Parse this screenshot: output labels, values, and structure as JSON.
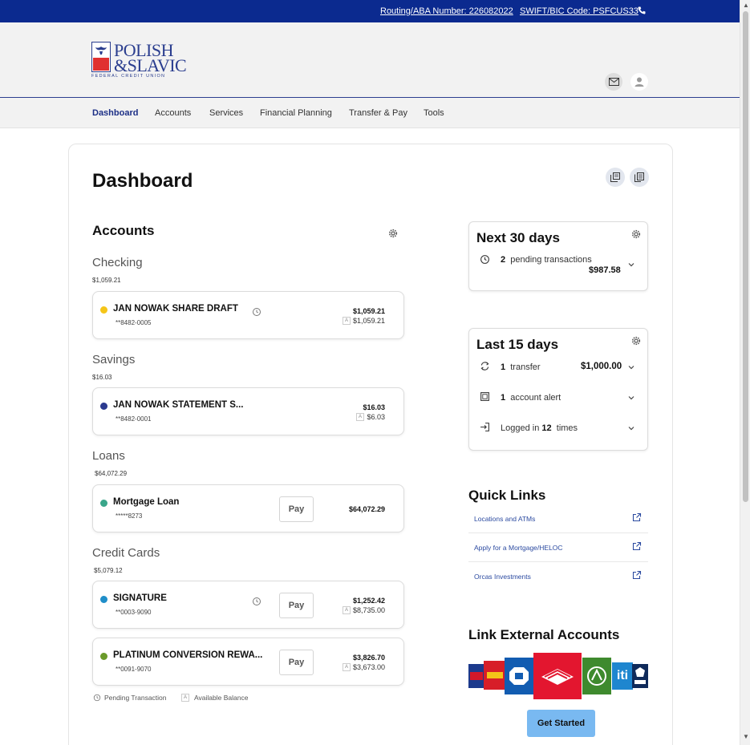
{
  "topbar": {
    "routing": "Routing/ABA Number: 226082022",
    "swift": "SWIFT/BIC Code: PSFCUS33"
  },
  "brand": {
    "line1": "POLISH",
    "line2": "&SLAVIC",
    "line3": "FEDERAL CREDIT UNION"
  },
  "nav": [
    "Dashboard",
    "Accounts",
    "Services",
    "Financial Planning",
    "Transfer & Pay",
    "Tools"
  ],
  "page": {
    "title": "Dashboard"
  },
  "accounts": {
    "heading": "Accounts",
    "checking": {
      "label": "Checking",
      "total": "$1,059.21"
    },
    "savings": {
      "label": "Savings",
      "total": "$16.03"
    },
    "loans": {
      "label": "Loans",
      "total": "$64,072.29"
    },
    "credit": {
      "label": "Credit Cards",
      "total": "$5,079.12"
    },
    "items": [
      {
        "name": "JAN NOWAK SHARE DRAFT",
        "number": "**8482-0005",
        "balance": "$1,059.21",
        "available": "$1,059.21",
        "dot_color": "#f5c518"
      },
      {
        "name": "JAN NOWAK STATEMENT S...",
        "number": "**8482-0001",
        "balance": "$16.03",
        "available": "$6.03",
        "dot_color": "#2b3a8f"
      },
      {
        "name": "Mortgage Loan",
        "number": "*****8273",
        "balance": "$64,072.29",
        "pay": "Pay",
        "dot_color": "#3aa68a"
      },
      {
        "name": "SIGNATURE",
        "number": "**0003-9090",
        "balance": "$1,252.42",
        "available": "$8,735.00",
        "pay": "Pay",
        "dot_color": "#1f8ec9"
      },
      {
        "name": "PLATINUM CONVERSION REWA...",
        "number": "**0091-9070",
        "balance": "$3,826.70",
        "available": "$3,673.00",
        "pay": "Pay",
        "dot_color": "#6a9a2a"
      }
    ],
    "legend": {
      "pending": "Pending Transaction",
      "available_marker": "A",
      "available": "Available Balance"
    }
  },
  "next30": {
    "title": "Next 30 days",
    "count": "2",
    "label": "pending transactions",
    "amount": "$987.58"
  },
  "last15": {
    "title": "Last 15 days",
    "transfer_count": "1",
    "transfer_label": "transfer",
    "transfer_amount": "$1,000.00",
    "alert_count": "1",
    "alert_label": "account alert",
    "login_prefix": "Logged in",
    "login_count": "12",
    "login_suffix": "times"
  },
  "quicklinks": {
    "title": "Quick Links",
    "items": [
      "Locations and ATMs",
      "Apply for a Mortgage/HELOC",
      "Orcas Investments"
    ]
  },
  "external": {
    "title": "Link External Accounts",
    "button": "Get Started"
  },
  "colors": {
    "topbar": "#0b2a8f",
    "brand": "#2b3e8f",
    "button": "#79b9f1"
  }
}
